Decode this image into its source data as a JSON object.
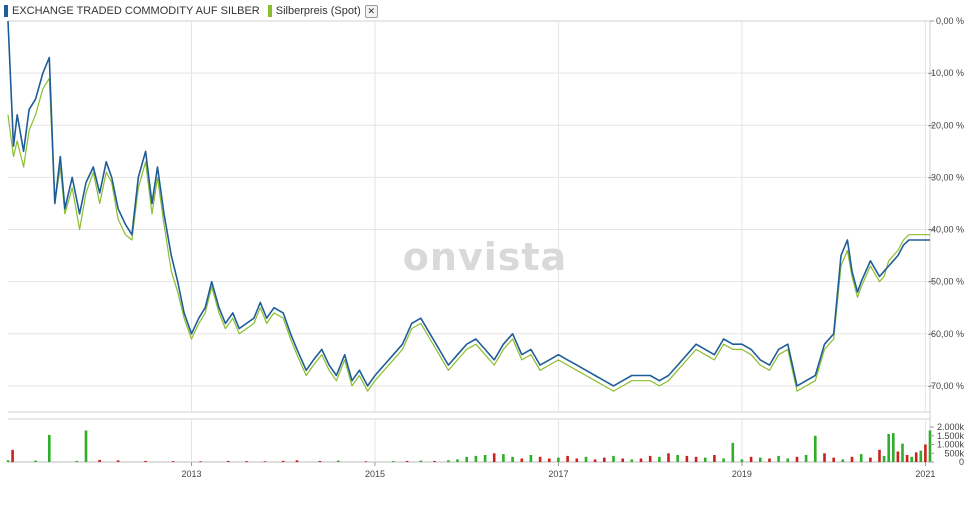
{
  "legend": {
    "series1": "EXCHANGE TRADED COMMODITY AUF SILBER",
    "series2": "Silberpreis (Spot)",
    "close_symbol": "✕"
  },
  "watermark": "onvista",
  "colors": {
    "etc": "#1f5d99",
    "spot": "#8bbd2e",
    "vol_up": "#2fae2a",
    "vol_down": "#c8231e",
    "grid": "#e5e5e5"
  },
  "chart_data": [
    {
      "type": "line",
      "ylim": [
        -75,
        0
      ],
      "xlim": [
        2011.0,
        2021.05
      ],
      "yticks": [
        0,
        -10,
        -20,
        -30,
        -40,
        -50,
        -60,
        -70
      ],
      "ytick_labels": [
        "0,00 %",
        "-10,00 %",
        "-20,00 %",
        "-30,00 %",
        "-40,00 %",
        "-50,00 %",
        "-60,00 %",
        "-70,00 %"
      ],
      "xticks": [
        2013,
        2015,
        2017,
        2019,
        2021
      ],
      "xtick_labels": [
        "2013",
        "2015",
        "2017",
        "2019",
        "2021"
      ],
      "series": [
        {
          "name": "EXCHANGE TRADED COMMODITY AUF SILBER",
          "x": [
            2011.0,
            2011.06,
            2011.1,
            2011.17,
            2011.23,
            2011.3,
            2011.38,
            2011.45,
            2011.51,
            2011.57,
            2011.62,
            2011.7,
            2011.78,
            2011.85,
            2011.93,
            2012.0,
            2012.07,
            2012.13,
            2012.2,
            2012.28,
            2012.35,
            2012.42,
            2012.5,
            2012.57,
            2012.63,
            2012.7,
            2012.78,
            2012.85,
            2012.92,
            2013.0,
            2013.08,
            2013.15,
            2013.22,
            2013.3,
            2013.37,
            2013.45,
            2013.52,
            2013.6,
            2013.68,
            2013.75,
            2013.82,
            2013.9,
            2014.0,
            2014.08,
            2014.15,
            2014.25,
            2014.33,
            2014.42,
            2014.5,
            2014.58,
            2014.67,
            2014.75,
            2014.83,
            2014.92,
            2015.0,
            2015.1,
            2015.2,
            2015.3,
            2015.4,
            2015.5,
            2015.6,
            2015.7,
            2015.8,
            2015.9,
            2016.0,
            2016.1,
            2016.2,
            2016.3,
            2016.4,
            2016.5,
            2016.6,
            2016.7,
            2016.8,
            2016.9,
            2017.0,
            2017.1,
            2017.2,
            2017.3,
            2017.4,
            2017.5,
            2017.6,
            2017.7,
            2017.8,
            2017.9,
            2018.0,
            2018.1,
            2018.2,
            2018.3,
            2018.4,
            2018.5,
            2018.6,
            2018.7,
            2018.8,
            2018.9,
            2019.0,
            2019.1,
            2019.2,
            2019.3,
            2019.4,
            2019.5,
            2019.6,
            2019.7,
            2019.8,
            2019.9,
            2020.0,
            2020.08,
            2020.15,
            2020.2,
            2020.26,
            2020.3,
            2020.4,
            2020.5,
            2020.55,
            2020.6,
            2020.65,
            2020.7,
            2020.76,
            2020.82,
            2020.88,
            2020.95,
            2021.0,
            2021.05
          ],
          "y": [
            0,
            -24,
            -18,
            -25,
            -17,
            -15,
            -10,
            -7,
            -35,
            -26,
            -36,
            -30,
            -37,
            -31,
            -28,
            -33,
            -27,
            -30,
            -36,
            -39,
            -41,
            -30,
            -25,
            -35,
            -28,
            -37,
            -45,
            -50,
            -56,
            -60,
            -57,
            -55,
            -50,
            -55,
            -58,
            -56,
            -59,
            -58,
            -57,
            -54,
            -57,
            -55,
            -56,
            -60,
            -63,
            -67,
            -65,
            -63,
            -66,
            -68,
            -64,
            -69,
            -67,
            -70,
            -68,
            -66,
            -64,
            -62,
            -58,
            -57,
            -60,
            -63,
            -66,
            -64,
            -62,
            -61,
            -63,
            -65,
            -62,
            -60,
            -64,
            -63,
            -66,
            -65,
            -64,
            -65,
            -66,
            -67,
            -68,
            -69,
            -70,
            -69,
            -68,
            -68,
            -68,
            -69,
            -68,
            -66,
            -64,
            -62,
            -63,
            -64,
            -61,
            -62,
            -62,
            -63,
            -65,
            -66,
            -63,
            -62,
            -70,
            -69,
            -68,
            -62,
            -60,
            -45,
            -42,
            -48,
            -52,
            -50,
            -46,
            -49,
            -48,
            -47,
            -46,
            -45,
            -43,
            -42,
            -42,
            -42,
            -42,
            -42
          ],
          "color": "#1f5d99"
        },
        {
          "name": "Silberpreis (Spot)",
          "x": [
            2011.0,
            2011.06,
            2011.1,
            2011.17,
            2011.23,
            2011.3,
            2011.38,
            2011.45,
            2011.51,
            2011.57,
            2011.62,
            2011.7,
            2011.78,
            2011.85,
            2011.93,
            2012.0,
            2012.07,
            2012.13,
            2012.2,
            2012.28,
            2012.35,
            2012.42,
            2012.5,
            2012.57,
            2012.63,
            2012.7,
            2012.78,
            2012.85,
            2012.92,
            2013.0,
            2013.08,
            2013.15,
            2013.22,
            2013.3,
            2013.37,
            2013.45,
            2013.52,
            2013.6,
            2013.68,
            2013.75,
            2013.82,
            2013.9,
            2014.0,
            2014.08,
            2014.15,
            2014.25,
            2014.33,
            2014.42,
            2014.5,
            2014.58,
            2014.67,
            2014.75,
            2014.83,
            2014.92,
            2015.0,
            2015.1,
            2015.2,
            2015.3,
            2015.4,
            2015.5,
            2015.6,
            2015.7,
            2015.8,
            2015.9,
            2016.0,
            2016.1,
            2016.2,
            2016.3,
            2016.4,
            2016.5,
            2016.6,
            2016.7,
            2016.8,
            2016.9,
            2017.0,
            2017.1,
            2017.2,
            2017.3,
            2017.4,
            2017.5,
            2017.6,
            2017.7,
            2017.8,
            2017.9,
            2018.0,
            2018.1,
            2018.2,
            2018.3,
            2018.4,
            2018.5,
            2018.6,
            2018.7,
            2018.8,
            2018.9,
            2019.0,
            2019.1,
            2019.2,
            2019.3,
            2019.4,
            2019.5,
            2019.6,
            2019.7,
            2019.8,
            2019.9,
            2020.0,
            2020.08,
            2020.15,
            2020.2,
            2020.26,
            2020.3,
            2020.4,
            2020.5,
            2020.55,
            2020.6,
            2020.65,
            2020.7,
            2020.76,
            2020.82,
            2020.88,
            2020.95,
            2021.0,
            2021.05
          ],
          "y": [
            -18,
            -26,
            -23,
            -28,
            -21,
            -18,
            -13,
            -11,
            -35,
            -28,
            -37,
            -32,
            -40,
            -33,
            -29,
            -35,
            -29,
            -31,
            -38,
            -41,
            -42,
            -32,
            -27,
            -37,
            -30,
            -39,
            -48,
            -52,
            -57,
            -61,
            -58,
            -56,
            -51,
            -56,
            -59,
            -57,
            -60,
            -59,
            -58,
            -55,
            -58,
            -56,
            -57,
            -61,
            -64,
            -68,
            -66,
            -64,
            -67,
            -69,
            -65,
            -70,
            -68,
            -71,
            -69,
            -67,
            -65,
            -63,
            -59,
            -58,
            -61,
            -64,
            -67,
            -65,
            -63,
            -62,
            -64,
            -66,
            -63,
            -61,
            -65,
            -64,
            -67,
            -66,
            -65,
            -66,
            -67,
            -68,
            -69,
            -70,
            -71,
            -70,
            -69,
            -69,
            -69,
            -70,
            -69,
            -67,
            -65,
            -63,
            -64,
            -65,
            -62,
            -63,
            -63,
            -64,
            -66,
            -67,
            -64,
            -63,
            -71,
            -70,
            -69,
            -63,
            -61,
            -47,
            -44,
            -49,
            -53,
            -51,
            -47,
            -50,
            -49,
            -46,
            -45,
            -44,
            -42,
            -41,
            -41,
            -41,
            -41,
            -41
          ],
          "color": "#8bbd2e"
        }
      ],
      "grid": true,
      "legend_position": "top-left"
    },
    {
      "type": "bar",
      "ylim": [
        0,
        2000
      ],
      "yticks": [
        0,
        500,
        1000,
        1500,
        2000
      ],
      "ytick_labels": [
        "0",
        "500k",
        "1.000k",
        "1.500k",
        "2.000k"
      ],
      "x": [
        2011.0,
        2011.05,
        2011.3,
        2011.45,
        2011.75,
        2011.85,
        2012.0,
        2012.2,
        2012.5,
        2012.8,
        2013.1,
        2013.4,
        2013.6,
        2013.8,
        2014.0,
        2014.15,
        2014.4,
        2014.6,
        2014.9,
        2015.2,
        2015.35,
        2015.5,
        2015.65,
        2015.8,
        2015.9,
        2016.0,
        2016.1,
        2016.2,
        2016.3,
        2016.4,
        2016.5,
        2016.6,
        2016.7,
        2016.8,
        2016.9,
        2017.0,
        2017.1,
        2017.2,
        2017.3,
        2017.4,
        2017.5,
        2017.6,
        2017.7,
        2017.8,
        2017.9,
        2018.0,
        2018.1,
        2018.2,
        2018.3,
        2018.4,
        2018.5,
        2018.6,
        2018.7,
        2018.8,
        2018.9,
        2019.0,
        2019.1,
        2019.2,
        2019.3,
        2019.4,
        2019.5,
        2019.6,
        2019.7,
        2019.8,
        2019.9,
        2020.0,
        2020.1,
        2020.2,
        2020.3,
        2020.4,
        2020.5,
        2020.55,
        2020.6,
        2020.65,
        2020.7,
        2020.75,
        2020.8,
        2020.85,
        2020.9,
        2020.95,
        2021.0,
        2021.05
      ],
      "values": [
        100,
        700,
        80,
        1550,
        60,
        1800,
        120,
        90,
        60,
        50,
        40,
        60,
        50,
        40,
        70,
        100,
        60,
        80,
        40,
        50,
        60,
        80,
        60,
        100,
        150,
        300,
        350,
        400,
        500,
        450,
        300,
        200,
        400,
        300,
        200,
        250,
        350,
        200,
        300,
        150,
        250,
        350,
        200,
        150,
        200,
        350,
        300,
        500,
        400,
        350,
        300,
        250,
        400,
        200,
        1100,
        150,
        300,
        250,
        200,
        350,
        200,
        300,
        400,
        1500,
        500,
        250,
        150,
        300,
        450,
        250,
        700,
        350,
        1600,
        1650,
        600,
        1050,
        400,
        300,
        550,
        650,
        1000,
        1800
      ],
      "direction": [
        "up",
        "down",
        "up",
        "up",
        "up",
        "up",
        "down",
        "down",
        "down",
        "down",
        "down",
        "down",
        "down",
        "down",
        "down",
        "down",
        "down",
        "up",
        "down",
        "up",
        "down",
        "up",
        "down",
        "up",
        "up",
        "up",
        "up",
        "up",
        "down",
        "up",
        "up",
        "down",
        "up",
        "down",
        "down",
        "up",
        "down",
        "down",
        "up",
        "down",
        "down",
        "up",
        "down",
        "up",
        "down",
        "down",
        "up",
        "down",
        "up",
        "down",
        "down",
        "up",
        "down",
        "up",
        "up",
        "up",
        "down",
        "up",
        "down",
        "up",
        "up",
        "down",
        "up",
        "up",
        "down",
        "down",
        "up",
        "down",
        "up",
        "down",
        "down",
        "up",
        "up",
        "up",
        "down",
        "up",
        "down",
        "up",
        "down",
        "up",
        "down",
        "up"
      ]
    }
  ]
}
